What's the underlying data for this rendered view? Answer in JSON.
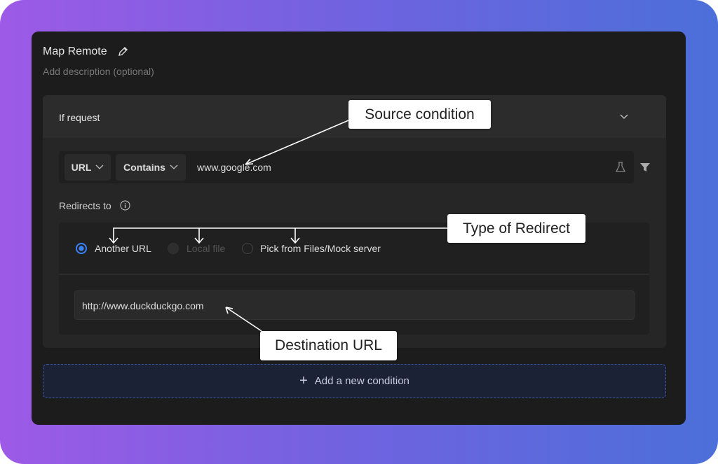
{
  "header": {
    "title": "Map Remote",
    "description_placeholder": "Add description (optional)"
  },
  "condition": {
    "section_title": "If request",
    "field": "URL",
    "operator": "Contains",
    "value": "www.google.com"
  },
  "redirect": {
    "label": "Redirects to",
    "options": [
      {
        "label": "Another URL",
        "selected": true,
        "disabled": false
      },
      {
        "label": "Local file",
        "selected": false,
        "disabled": true
      },
      {
        "label": "Pick from Files/Mock server",
        "selected": false,
        "disabled": false
      }
    ],
    "destination": "http://www.duckduckgo.com"
  },
  "add_condition": "Add a new condition",
  "annotations": {
    "source": "Source condition",
    "type": "Type of Redirect",
    "destination": "Destination URL"
  },
  "colors": {
    "accent": "#3b82f6"
  }
}
